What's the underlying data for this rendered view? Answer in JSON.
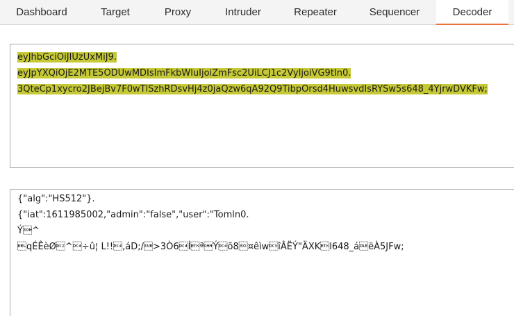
{
  "tabs": [
    {
      "label": "Dashboard",
      "active": false
    },
    {
      "label": "Target",
      "active": false
    },
    {
      "label": "Proxy",
      "active": false
    },
    {
      "label": "Intruder",
      "active": false
    },
    {
      "label": "Repeater",
      "active": false
    },
    {
      "label": "Sequencer",
      "active": false
    },
    {
      "label": "Decoder",
      "active": true
    }
  ],
  "colors": {
    "active_tab_underline": "#e8743b",
    "selection_highlight": "#c6c936"
  },
  "encoded_panel": {
    "lines": [
      "eyJhbGciOiJIUzUxMiJ9.",
      "eyJpYXQiOjE2MTE5ODUwMDIsImFkbWluIjoiZmFsc2UiLCJ1c2VyIjoiVG9tIn0.",
      "3QteCp1xycro2JBejBv7F0wTlSzhRDsvHj4z0jaQzw6qA92Q9TibpOrsd4HuwsvdIsRYSw5s648_4YjrwDVKFw;"
    ]
  },
  "decoded_panel": {
    "lines": [
      "{\"alg\":\"HS512\"}.",
      "{\"iat\":1611985002,\"admin\":\"false\",\"user\":\"Tomln0.",
      "Ý\u0001^",
      "\u0007qÉÊèØ\u0012^\u0014÷û¦ L!!\u0014,áD;/\u001a>3Ò6\u0014Í\u0003ª\u0018Ý\u0014õ8\u000e¤êìw\u0013îÂËÝ\"ÄXK\u0003l648_á\u0010ëÀ5JFw;"
    ]
  }
}
